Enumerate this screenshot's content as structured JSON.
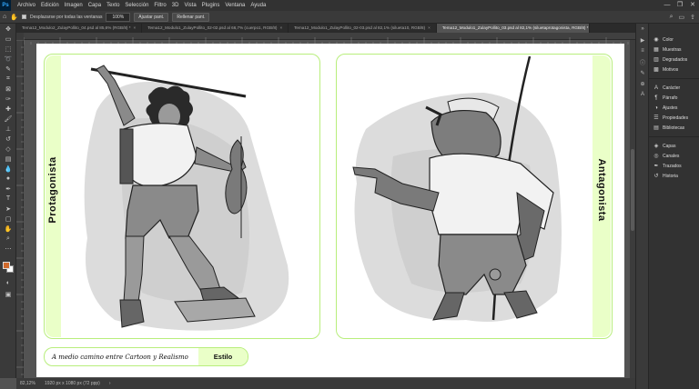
{
  "app": {
    "logo": "Ps",
    "menu": [
      "Archivo",
      "Edición",
      "Imagen",
      "Capa",
      "Texto",
      "Selección",
      "Filtro",
      "3D",
      "Vista",
      "Plugins",
      "Ventana",
      "Ayuda"
    ],
    "window_controls": [
      "—",
      "❐",
      "✕"
    ]
  },
  "options_bar": {
    "scroll_all_label": "Desplazarse por todas las ventanas",
    "zoom_value": "100%",
    "fit_screen": "Ajustar pant.",
    "fill_screen": "Rellenar pant."
  },
  "tabs": [
    {
      "label": "Tema12_Modulo2_ZulayPollito_04.psd al 85,6% (RGB/8) *",
      "active": false
    },
    {
      "label": "Tema12_Modulo1_ZulayPollito_02-02.psd al 66,7% (cuerpo1, RGB/8)",
      "active": false
    },
    {
      "label": "Tema12_Modulo1_ZulayPollito_02-03.psd al 82,1% (silueta10, RGB/8)",
      "active": false
    },
    {
      "label": "Tema12_Modulo1_ZulayPollito_03.psd al 82,1% (siluetaprotagonista, RGB/8) *",
      "active": true
    }
  ],
  "document": {
    "left_label": "Protagonista",
    "right_label": "Antagonista",
    "style_desc": "A medio camino entre Cartoon y Realismo",
    "style_tag": "Estilo"
  },
  "status": {
    "zoom": "82,12%",
    "size": "1920 px x 1080 px (72 ppp)"
  },
  "panels": [
    {
      "label": "Color",
      "icon": "color-wheel-icon"
    },
    {
      "label": "Muestras",
      "icon": "swatches-grid-icon"
    },
    {
      "label": "Degradados",
      "icon": "gradient-icon"
    },
    {
      "label": "Motivos",
      "icon": "pattern-icon"
    },
    {
      "label": "Carácter",
      "icon": "character-icon"
    },
    {
      "label": "Párrafo",
      "icon": "paragraph-icon"
    },
    {
      "label": "Ajustes",
      "icon": "adjustments-icon"
    },
    {
      "label": "Propiedades",
      "icon": "properties-icon"
    },
    {
      "label": "Bibliotecas",
      "icon": "libraries-icon"
    },
    {
      "label": "Capas",
      "icon": "layers-icon"
    },
    {
      "label": "Canales",
      "icon": "channels-icon"
    },
    {
      "label": "Trazados",
      "icon": "paths-icon"
    },
    {
      "label": "Historia",
      "icon": "history-icon"
    }
  ],
  "colors": {
    "frame_green": "#b8ee7c",
    "label_green": "#eaffc8",
    "foreground": "#d06a2c",
    "background": "#ffffff"
  }
}
